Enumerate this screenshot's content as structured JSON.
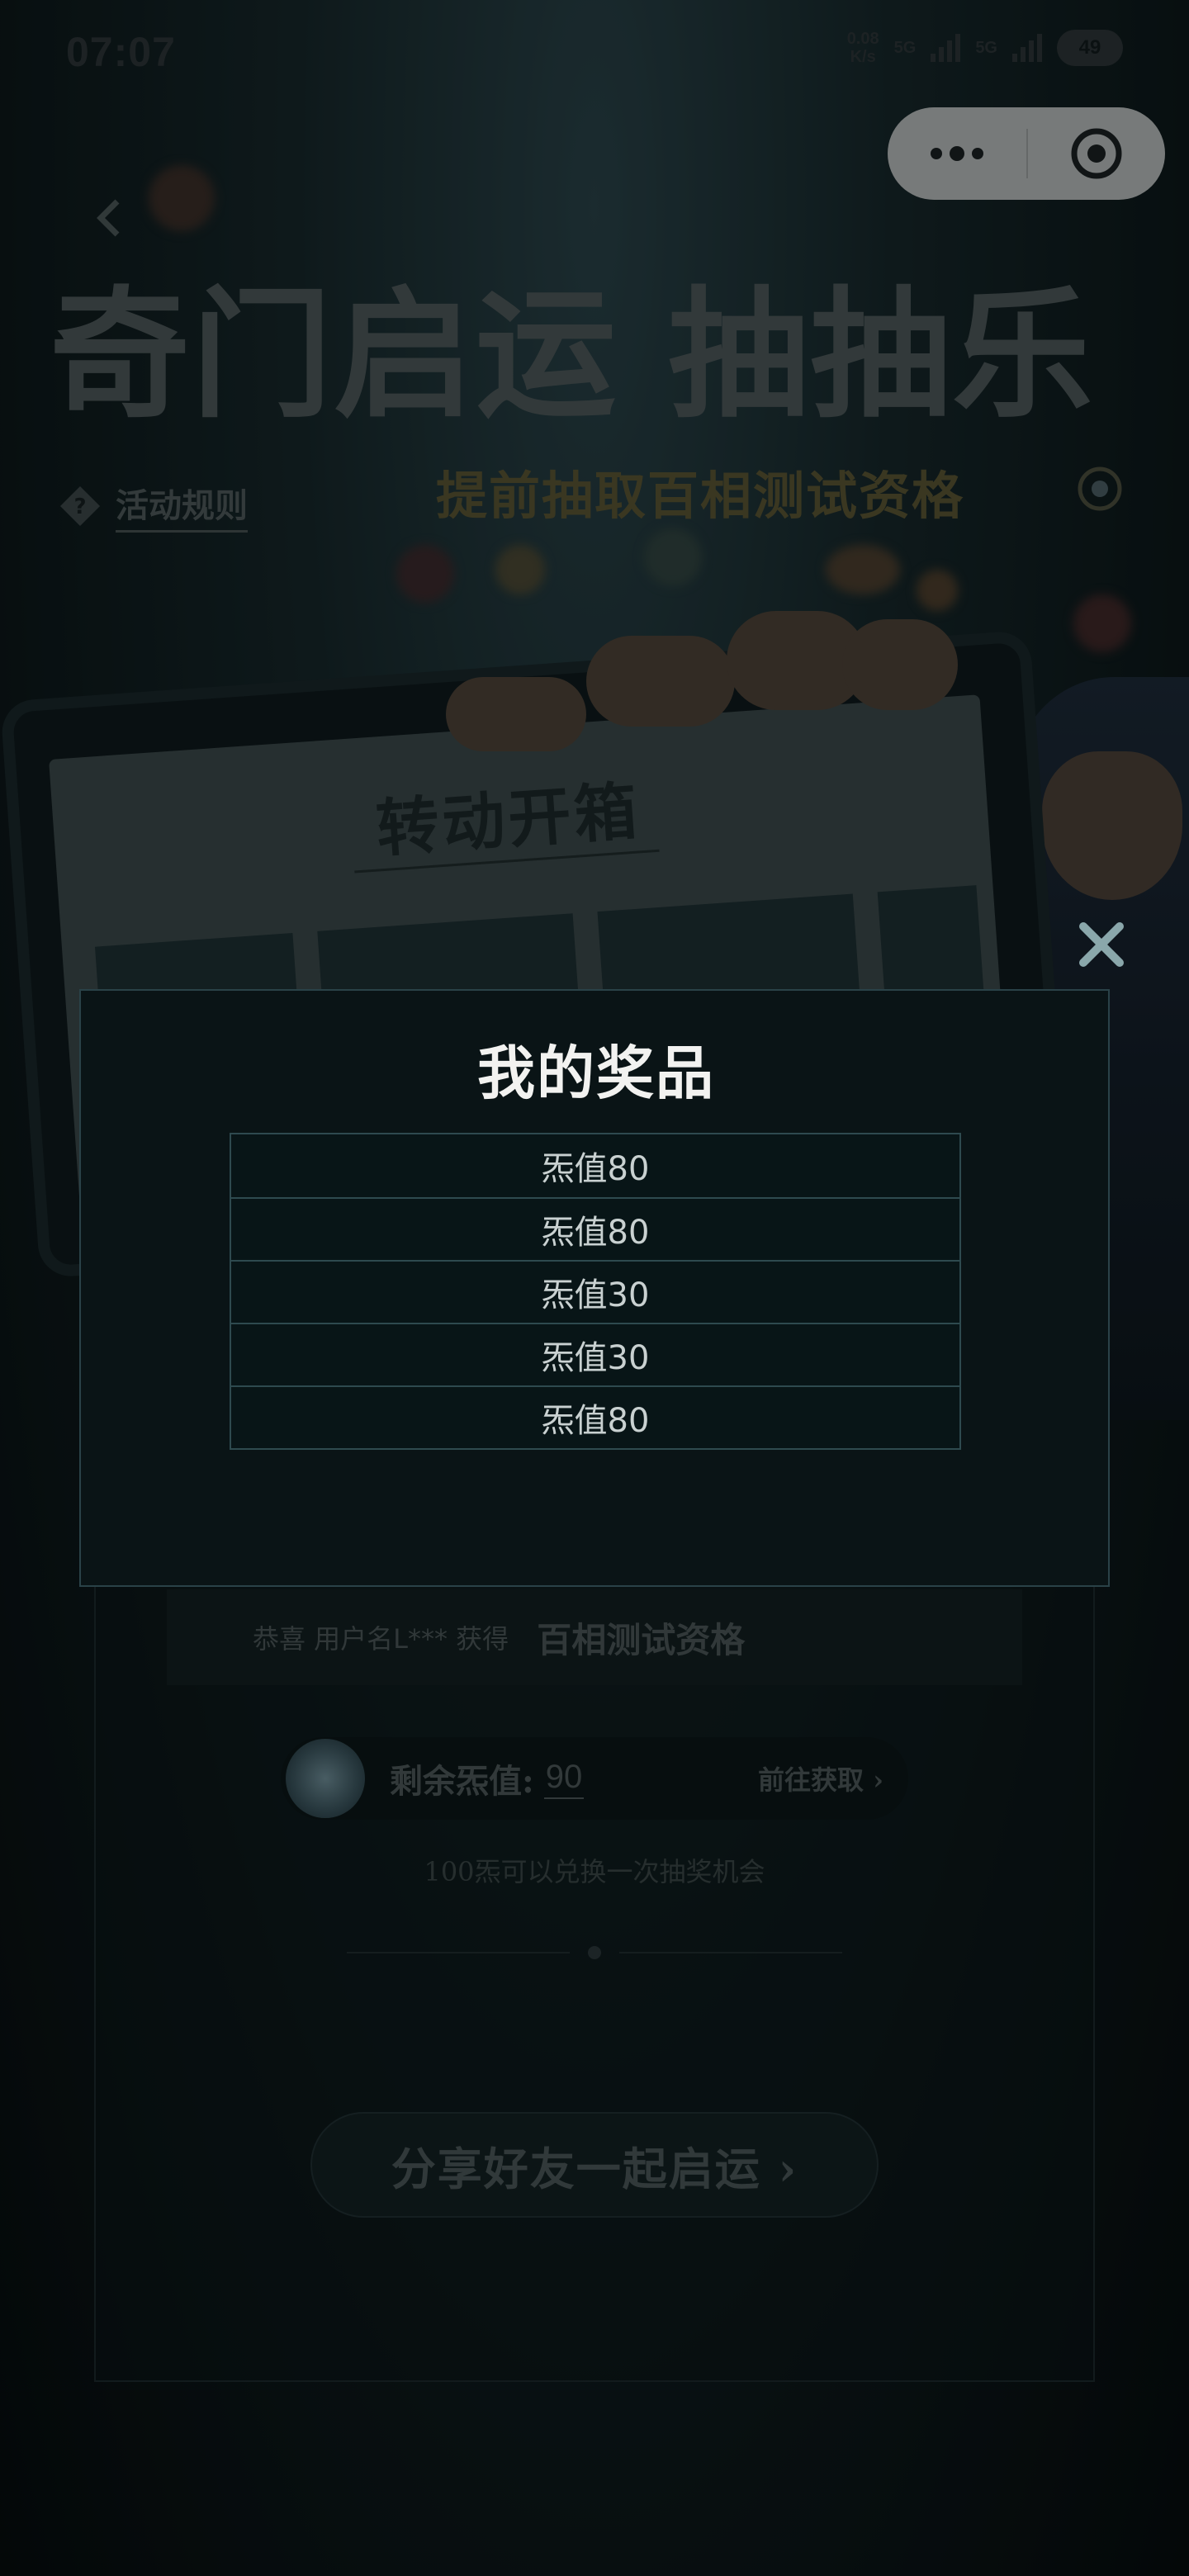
{
  "status_bar": {
    "time": "07:07",
    "net_speed_value": "0.08",
    "net_speed_unit": "K/s",
    "signal_label_1": "5G",
    "signal_label_2": "5G",
    "battery": "49"
  },
  "page": {
    "title": "奇门启运 抽抽乐",
    "rules_label": "活动规则",
    "subtitle": "提前抽取百相测试资格"
  },
  "illustration": {
    "box_title": "转动开箱"
  },
  "winner_banner": {
    "congrats_text": "恭喜 用户名L*** 获得",
    "prize_name": "百相测试资格"
  },
  "balance": {
    "label": "剩余炁值:",
    "value": "90",
    "get_more": "前往获取 ›"
  },
  "exchange_note": "100炁可以兑换一次抽奖机会",
  "share_button": {
    "label": "分享好友一起启运 ›"
  },
  "modal": {
    "title": "我的奖品",
    "prizes": [
      "炁值80",
      "炁值80",
      "炁值30",
      "炁值30",
      "炁值80"
    ]
  },
  "colors": {
    "modal_background": "#0a1416",
    "modal_border": "#2a4248",
    "close_icon": "#8aa7ab",
    "subtitle_gold": "#58502f"
  }
}
